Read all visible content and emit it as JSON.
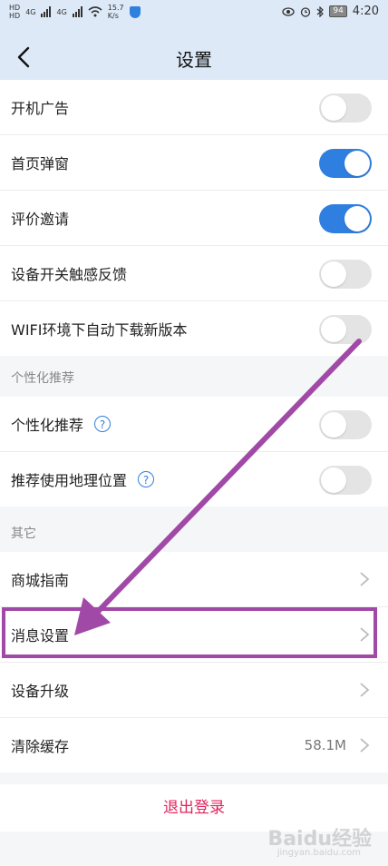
{
  "status_bar": {
    "hd1": "HD",
    "hd2": "HD",
    "net1": "4G",
    "net2": "4G",
    "speed_value": "15.7",
    "speed_unit": "K/s",
    "battery": "94",
    "time": "4:20"
  },
  "nav": {
    "title": "设置"
  },
  "section_general": {
    "items": [
      {
        "label": "开机广告",
        "toggle": false
      },
      {
        "label": "首页弹窗",
        "toggle": true
      },
      {
        "label": "评价邀请",
        "toggle": true
      },
      {
        "label": "设备开关触感反馈",
        "toggle": false
      },
      {
        "label": "WIFI环境下自动下载新版本",
        "toggle": false
      }
    ]
  },
  "section_personalize": {
    "header": "个性化推荐",
    "items": [
      {
        "label": "个性化推荐",
        "help": "?",
        "toggle": false
      },
      {
        "label": "推荐使用地理位置",
        "help": "?",
        "toggle": false
      }
    ]
  },
  "section_other": {
    "header": "其它",
    "items": [
      {
        "label": "商城指南"
      },
      {
        "label": "消息设置"
      },
      {
        "label": "设备升级"
      },
      {
        "label": "清除缓存",
        "value": "58.1M"
      }
    ]
  },
  "logout": {
    "label": "退出登录"
  },
  "watermark": {
    "text": "Baidu经验",
    "sub": "jingyan.baidu.com"
  },
  "colors": {
    "accent": "#2f7fe0",
    "logout": "#e0245e",
    "annotation": "#a149a7"
  }
}
